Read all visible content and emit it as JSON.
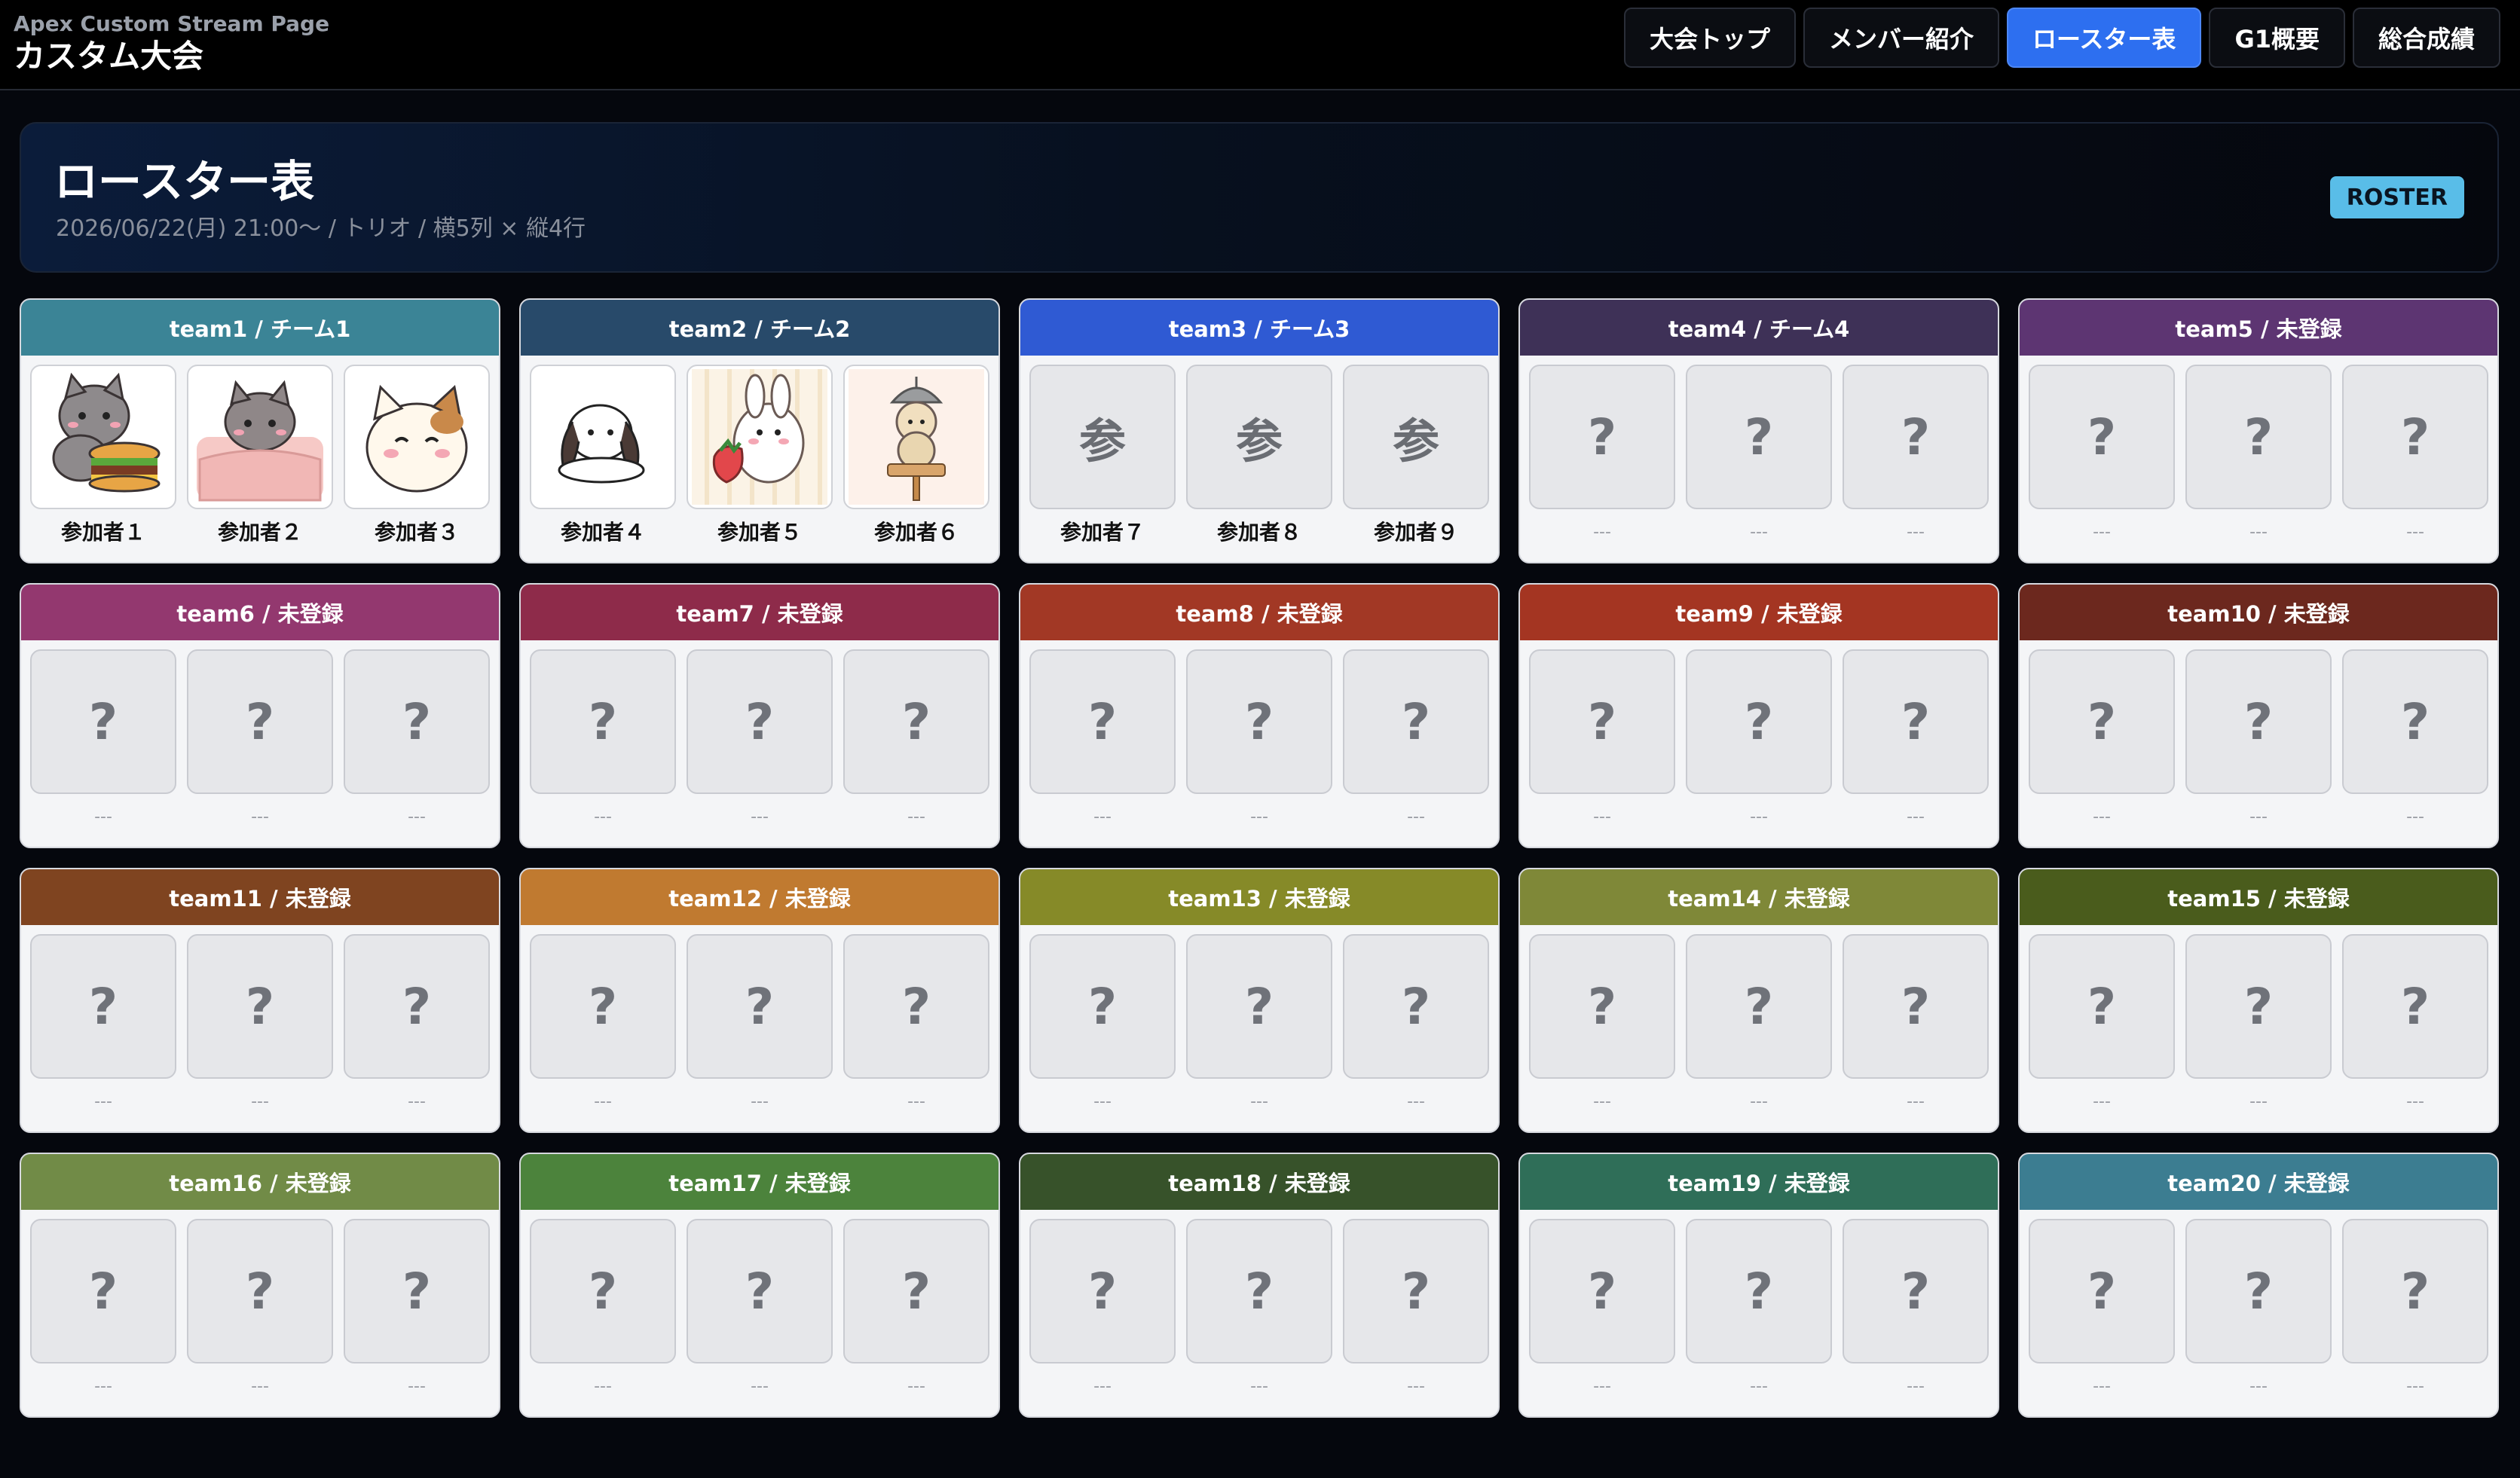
{
  "app": {
    "subtitle": "Apex Custom Stream Page",
    "title": "カスタム大会"
  },
  "nav": [
    {
      "label": "大会トップ",
      "active": false
    },
    {
      "label": "メンバー紹介",
      "active": false
    },
    {
      "label": "ロースター表",
      "active": true
    },
    {
      "label": "G1概要",
      "active": false
    },
    {
      "label": "総合成績",
      "active": false
    }
  ],
  "hero": {
    "title": "ロースター表",
    "subtitle": "2026/06/22(月) 21:00〜 / トリオ / 横5列 × 縦4行",
    "badge": "ROSTER"
  },
  "teams": [
    {
      "label": "team1 / チーム1",
      "color": "#3b8496",
      "members": [
        {
          "name": "参加者１",
          "kind": "image",
          "icon": "cat-burger-icon"
        },
        {
          "name": "参加者２",
          "kind": "image",
          "icon": "cat-sleeping-icon"
        },
        {
          "name": "参加者３",
          "kind": "image",
          "icon": "cat-smile-icon"
        }
      ]
    },
    {
      "label": "team2 / チーム2",
      "color": "#284a6a",
      "members": [
        {
          "name": "参加者４",
          "kind": "image",
          "icon": "bunny-lop-icon"
        },
        {
          "name": "参加者５",
          "kind": "image",
          "icon": "bunny-strawberry-icon"
        },
        {
          "name": "参加者６",
          "kind": "image",
          "icon": "dango-icon"
        }
      ]
    },
    {
      "label": "team3 / チーム3",
      "color": "#2f5ad3",
      "members": [
        {
          "name": "参加者７",
          "kind": "kanji",
          "glyph": "参"
        },
        {
          "name": "参加者８",
          "kind": "kanji",
          "glyph": "参"
        },
        {
          "name": "参加者９",
          "kind": "kanji",
          "glyph": "参"
        }
      ]
    },
    {
      "label": "team4 / チーム4",
      "color": "#3e3157",
      "members": [
        {
          "name": "---",
          "kind": "empty",
          "glyph": "?"
        },
        {
          "name": "---",
          "kind": "empty",
          "glyph": "?"
        },
        {
          "name": "---",
          "kind": "empty",
          "glyph": "?"
        }
      ]
    },
    {
      "label": "team5 / 未登録",
      "color": "#5d3572",
      "members": [
        {
          "name": "---",
          "kind": "empty",
          "glyph": "?"
        },
        {
          "name": "---",
          "kind": "empty",
          "glyph": "?"
        },
        {
          "name": "---",
          "kind": "empty",
          "glyph": "?"
        }
      ]
    },
    {
      "label": "team6 / 未登録",
      "color": "#93386f",
      "members": [
        {
          "name": "---",
          "kind": "empty",
          "glyph": "?"
        },
        {
          "name": "---",
          "kind": "empty",
          "glyph": "?"
        },
        {
          "name": "---",
          "kind": "empty",
          "glyph": "?"
        }
      ]
    },
    {
      "label": "team7 / 未登録",
      "color": "#8e2b4a",
      "members": [
        {
          "name": "---",
          "kind": "empty",
          "glyph": "?"
        },
        {
          "name": "---",
          "kind": "empty",
          "glyph": "?"
        },
        {
          "name": "---",
          "kind": "empty",
          "glyph": "?"
        }
      ]
    },
    {
      "label": "team8 / 未登録",
      "color": "#a23825",
      "members": [
        {
          "name": "---",
          "kind": "empty",
          "glyph": "?"
        },
        {
          "name": "---",
          "kind": "empty",
          "glyph": "?"
        },
        {
          "name": "---",
          "kind": "empty",
          "glyph": "?"
        }
      ]
    },
    {
      "label": "team9 / 未登録",
      "color": "#a43522",
      "members": [
        {
          "name": "---",
          "kind": "empty",
          "glyph": "?"
        },
        {
          "name": "---",
          "kind": "empty",
          "glyph": "?"
        },
        {
          "name": "---",
          "kind": "empty",
          "glyph": "?"
        }
      ]
    },
    {
      "label": "team10 / 未登録",
      "color": "#6c281e",
      "members": [
        {
          "name": "---",
          "kind": "empty",
          "glyph": "?"
        },
        {
          "name": "---",
          "kind": "empty",
          "glyph": "?"
        },
        {
          "name": "---",
          "kind": "empty",
          "glyph": "?"
        }
      ]
    },
    {
      "label": "team11 / 未登録",
      "color": "#7f4420",
      "members": [
        {
          "name": "---",
          "kind": "empty",
          "glyph": "?"
        },
        {
          "name": "---",
          "kind": "empty",
          "glyph": "?"
        },
        {
          "name": "---",
          "kind": "empty",
          "glyph": "?"
        }
      ]
    },
    {
      "label": "team12 / 未登録",
      "color": "#c07a30",
      "members": [
        {
          "name": "---",
          "kind": "empty",
          "glyph": "?"
        },
        {
          "name": "---",
          "kind": "empty",
          "glyph": "?"
        },
        {
          "name": "---",
          "kind": "empty",
          "glyph": "?"
        }
      ]
    },
    {
      "label": "team13 / 未登録",
      "color": "#868a28",
      "members": [
        {
          "name": "---",
          "kind": "empty",
          "glyph": "?"
        },
        {
          "name": "---",
          "kind": "empty",
          "glyph": "?"
        },
        {
          "name": "---",
          "kind": "empty",
          "glyph": "?"
        }
      ]
    },
    {
      "label": "team14 / 未登録",
      "color": "#7f8838",
      "members": [
        {
          "name": "---",
          "kind": "empty",
          "glyph": "?"
        },
        {
          "name": "---",
          "kind": "empty",
          "glyph": "?"
        },
        {
          "name": "---",
          "kind": "empty",
          "glyph": "?"
        }
      ]
    },
    {
      "label": "team15 / 未登録",
      "color": "#4a5c1c",
      "members": [
        {
          "name": "---",
          "kind": "empty",
          "glyph": "?"
        },
        {
          "name": "---",
          "kind": "empty",
          "glyph": "?"
        },
        {
          "name": "---",
          "kind": "empty",
          "glyph": "?"
        }
      ]
    },
    {
      "label": "team16 / 未登録",
      "color": "#718b47",
      "members": [
        {
          "name": "---",
          "kind": "empty",
          "glyph": "?"
        },
        {
          "name": "---",
          "kind": "empty",
          "glyph": "?"
        },
        {
          "name": "---",
          "kind": "empty",
          "glyph": "?"
        }
      ]
    },
    {
      "label": "team17 / 未登録",
      "color": "#4c833c",
      "members": [
        {
          "name": "---",
          "kind": "empty",
          "glyph": "?"
        },
        {
          "name": "---",
          "kind": "empty",
          "glyph": "?"
        },
        {
          "name": "---",
          "kind": "empty",
          "glyph": "?"
        }
      ]
    },
    {
      "label": "team18 / 未登録",
      "color": "#37522a",
      "members": [
        {
          "name": "---",
          "kind": "empty",
          "glyph": "?"
        },
        {
          "name": "---",
          "kind": "empty",
          "glyph": "?"
        },
        {
          "name": "---",
          "kind": "empty",
          "glyph": "?"
        }
      ]
    },
    {
      "label": "team19 / 未登録",
      "color": "#2f6e58",
      "members": [
        {
          "name": "---",
          "kind": "empty",
          "glyph": "?"
        },
        {
          "name": "---",
          "kind": "empty",
          "glyph": "?"
        },
        {
          "name": "---",
          "kind": "empty",
          "glyph": "?"
        }
      ]
    },
    {
      "label": "team20 / 未登録",
      "color": "#3c7d91",
      "members": [
        {
          "name": "---",
          "kind": "empty",
          "glyph": "?"
        },
        {
          "name": "---",
          "kind": "empty",
          "glyph": "?"
        },
        {
          "name": "---",
          "kind": "empty",
          "glyph": "?"
        }
      ]
    }
  ]
}
